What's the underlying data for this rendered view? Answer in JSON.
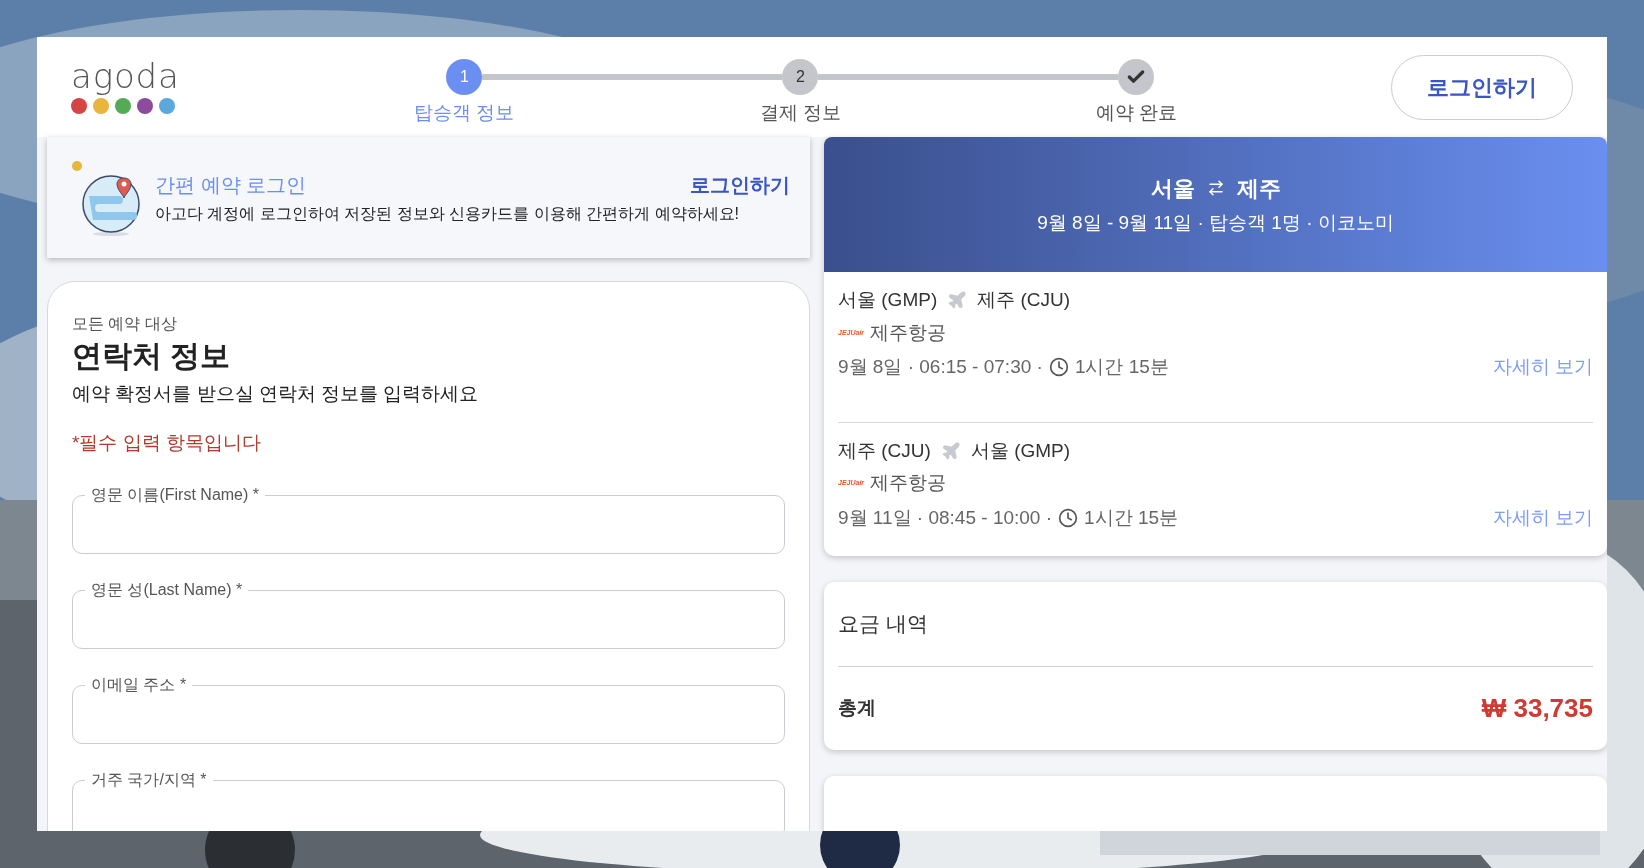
{
  "header": {
    "logo_text": "agoda",
    "steps": [
      {
        "kind": "number",
        "number": "1",
        "label": "탑승객 정보",
        "selected": true
      },
      {
        "kind": "number",
        "number": "2",
        "label": "결제 정보",
        "selected": false
      },
      {
        "kind": "check",
        "label": "예약 완료",
        "selected": false
      }
    ],
    "login_button": "로그인하기"
  },
  "login_banner": {
    "title": "간편 예약 로그인",
    "description": "아고다 계정에 로그인하여 저장된 정보와 신용카드를 이용해 간편하게 예약하세요!",
    "link": "로그인하기"
  },
  "contact_form": {
    "eyebrow": "모든 예약 대상",
    "title": "연락처 정보",
    "subtitle": "예약 확정서를 받으실 연락처 정보를 입력하세요",
    "required_note": "*필수 입력 항목입니다",
    "fields": [
      {
        "label": "영문 이름(First Name) *"
      },
      {
        "label": "영문 성(Last Name) *"
      },
      {
        "label": "이메일 주소 *"
      },
      {
        "label": "거주 국가/지역 *"
      }
    ]
  },
  "trip_summary": {
    "origin": "서울",
    "destination": "제주",
    "details": "9월 8일 - 9월 11일 · 탑승객 1명 · 이코노미",
    "legs": [
      {
        "from": "서울 (GMP)",
        "to": "제주 (CJU)",
        "airline_logo": "JEJUair",
        "airline": "제주항공",
        "schedule": "9월 8일 · 06:15 - 07:30 ·",
        "duration": "1시간 15분",
        "link": "자세히 보기"
      },
      {
        "from": "제주 (CJU)",
        "to": "서울 (GMP)",
        "airline_logo": "JEJUair",
        "airline": "제주항공",
        "schedule": "9월 11일 · 08:45 - 10:00 ·",
        "duration": "1시간 15분",
        "link": "자세히 보기"
      }
    ]
  },
  "price_breakdown": {
    "title": "요금 내역",
    "total_label": "총계",
    "total": "₩ 33,735"
  }
}
